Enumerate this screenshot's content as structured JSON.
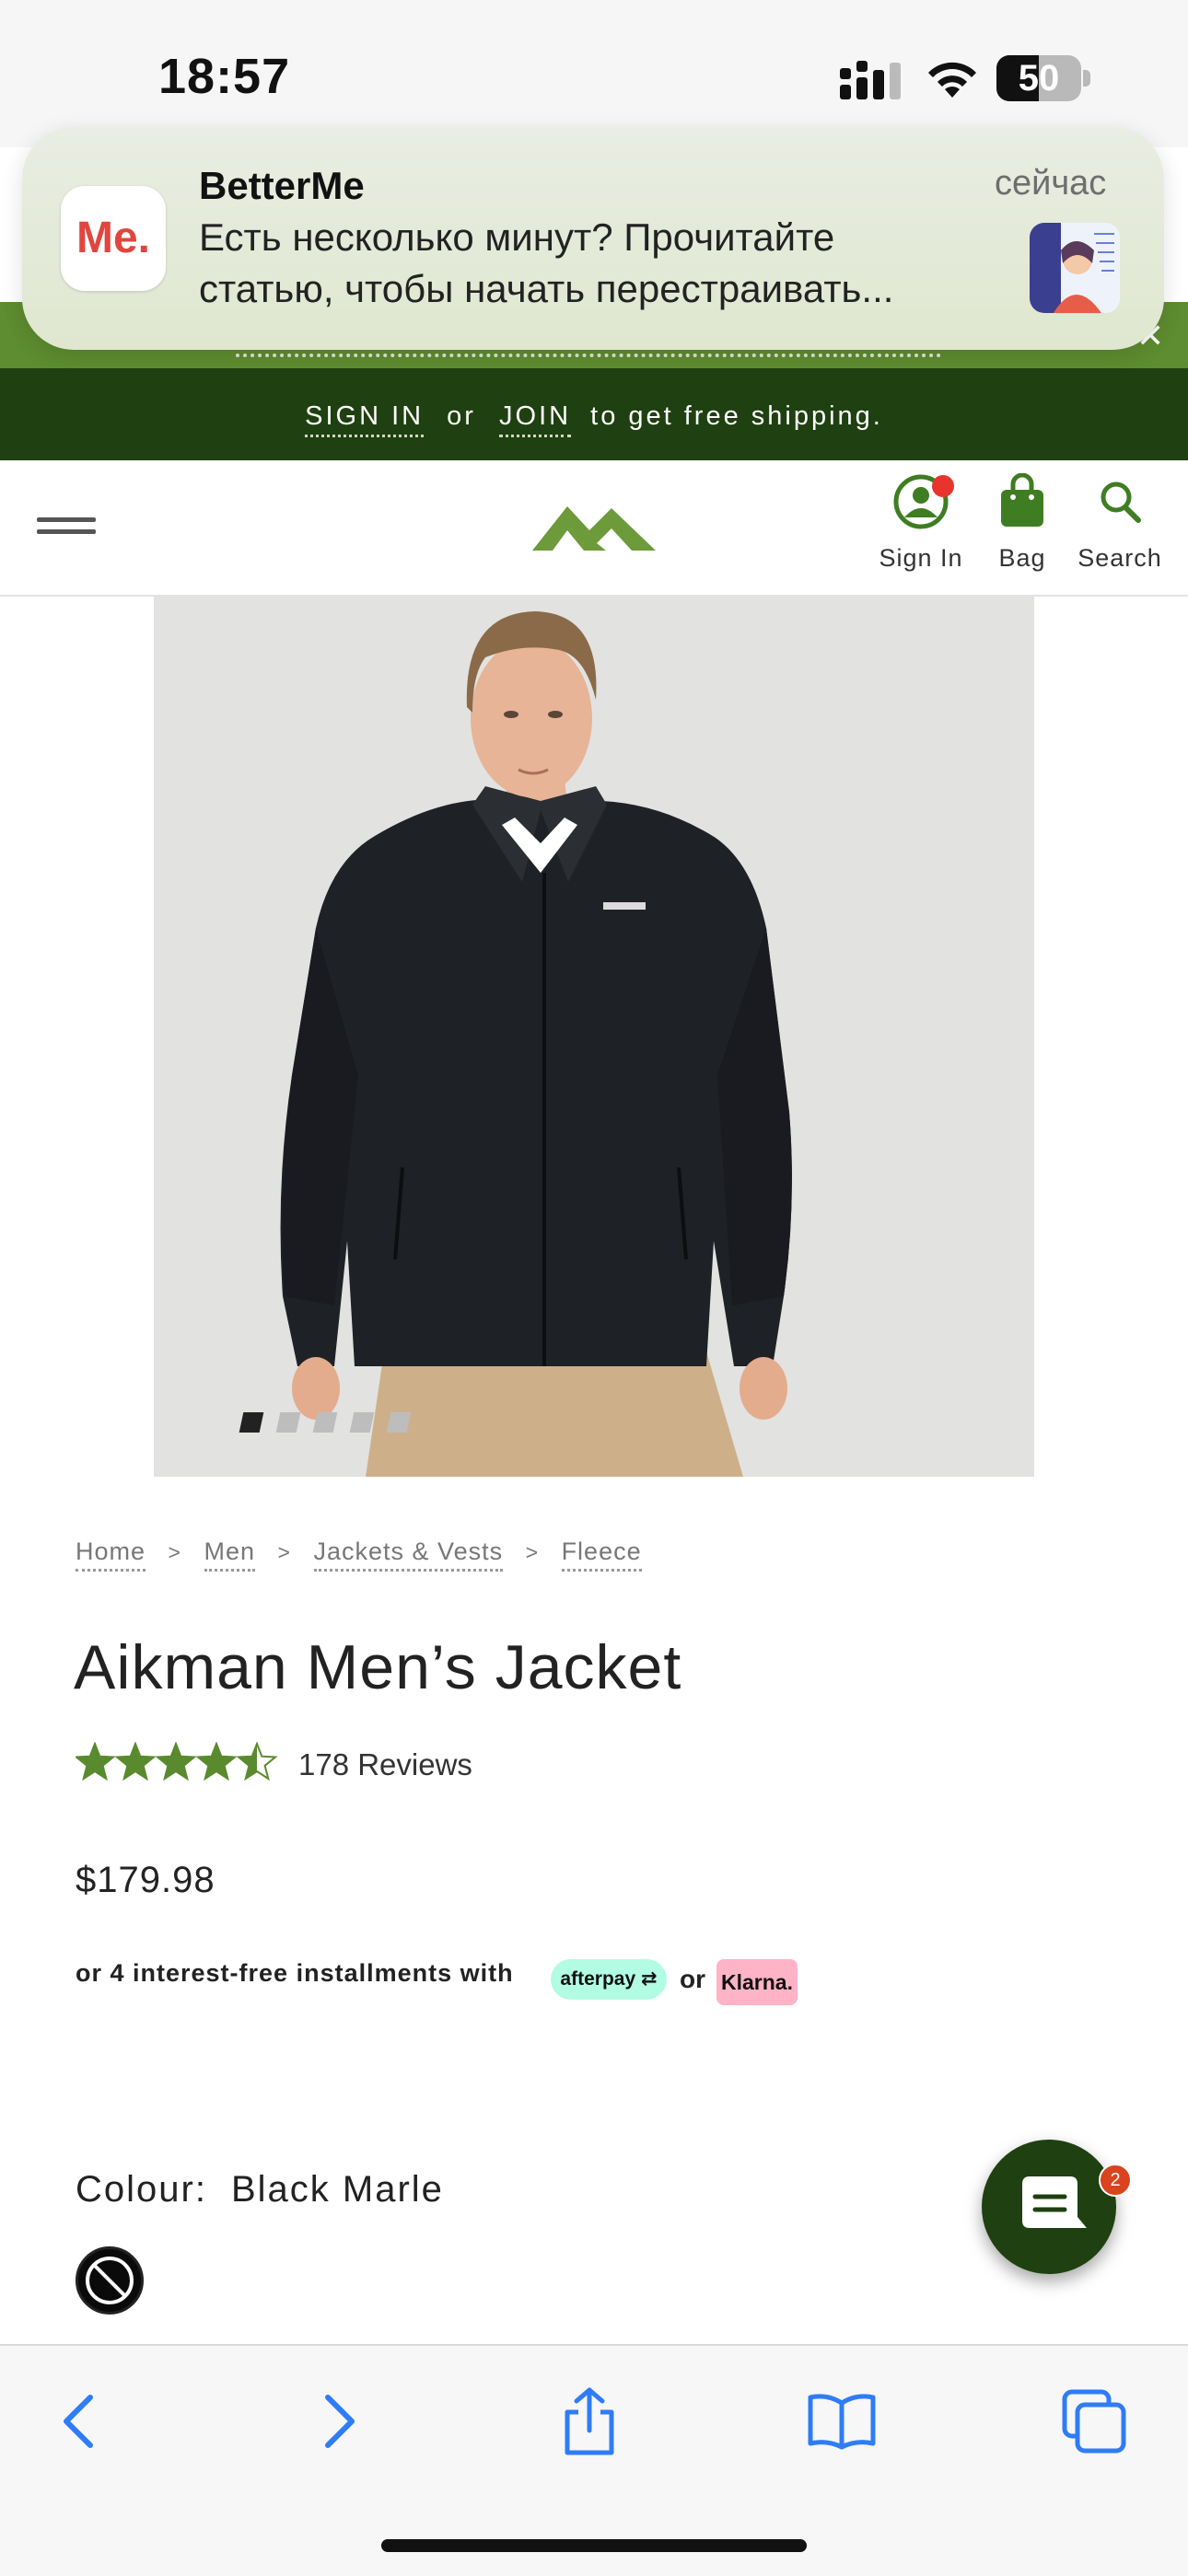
{
  "status_bar": {
    "time": "18:57",
    "battery_level": "50",
    "battery_fraction": 0.5
  },
  "notification": {
    "app_name": "BetterMe",
    "app_icon_text": "Me.",
    "time": "сейчас",
    "body": "Есть несколько минут? Прочитайте статью, чтобы начать перестраивать..."
  },
  "promo": {
    "sign_in": "SIGN IN",
    "or": "or",
    "join": "JOIN",
    "suffix": "to get free shipping."
  },
  "header": {
    "sign_in_label": "Sign In",
    "bag_label": "Bag",
    "search_label": "Search"
  },
  "carousel": {
    "count": 5,
    "active_index": 0
  },
  "breadcrumb": [
    "Home",
    "Men",
    "Jackets & Vests",
    "Fleece"
  ],
  "breadcrumb_separator": ">",
  "product": {
    "title": "Aikman Men’s Jacket",
    "rating": 4.5,
    "rating_max": 5,
    "reviews": "178 Reviews",
    "price": "$179.98",
    "installments_text": "or 4 interest-free installments with",
    "afterpay_label": "afterpay",
    "or_text": "or",
    "klarna_label": "Klarna.",
    "colour_label": "Colour:",
    "colour_value": "Black Marle"
  },
  "chat": {
    "badge_count": "2"
  },
  "colors": {
    "brand_green": "#1f4010",
    "accent_green": "#5e8c30",
    "star_green": "#5a8a2e",
    "link_blue": "#2f7cf6"
  }
}
